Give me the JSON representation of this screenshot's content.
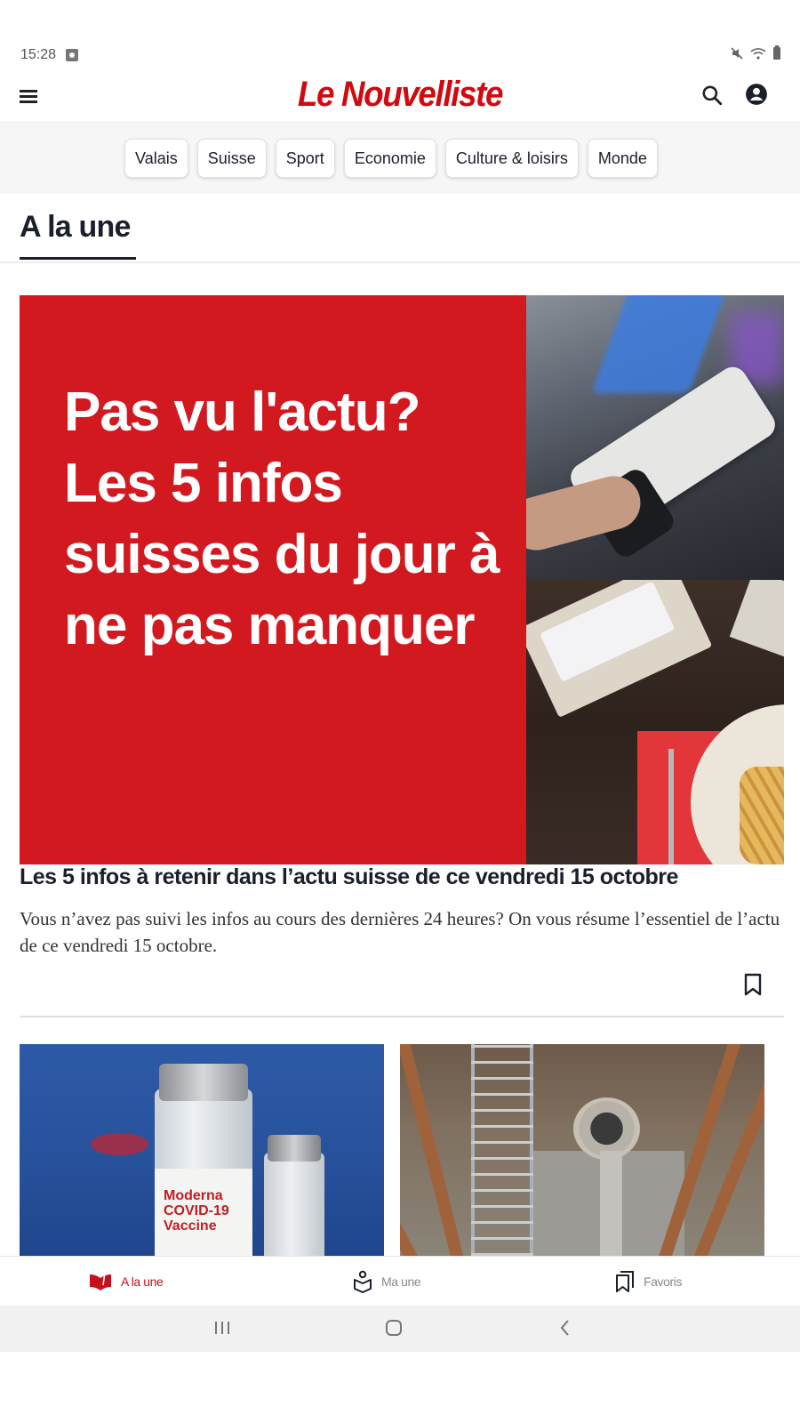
{
  "status_bar": {
    "time": "15:28",
    "icons": [
      "screen-record-icon",
      "mute-icon",
      "wifi-icon",
      "battery-icon"
    ]
  },
  "header": {
    "logo": "Le Nouvelliste",
    "menu_icon": "hamburger-menu-icon",
    "search_icon": "search-icon",
    "account_icon": "account-circle-icon"
  },
  "categories": [
    {
      "label": "Valais"
    },
    {
      "label": "Suisse"
    },
    {
      "label": "Sport"
    },
    {
      "label": "Economie"
    },
    {
      "label": "Culture & loisirs"
    },
    {
      "label": "Monde"
    }
  ],
  "section": {
    "title": "A la une"
  },
  "hero": {
    "image_text": "Pas vu l'actu? Les 5 infos suisses du jour à ne pas manquer",
    "title": "Les 5 infos à retenir dans l’actu suisse de ce vendredi 15 octobre",
    "summary": "Vous n’avez pas suivi les infos au cours des dernières 24 heures? On vous résume l’essentiel de l’actu de ce vendredi 15 octobre.",
    "bookmark_icon": "bookmark-icon",
    "accent_color": "#d21920"
  },
  "cards": [
    {
      "image": "covid-vaccine-vials",
      "label_text": "Moderna COVID-19 Vaccine"
    },
    {
      "image": "construction-pit-tunnel"
    }
  ],
  "bottom_nav": {
    "items": [
      {
        "label": "A la une",
        "icon": "open-book-icon",
        "active": true
      },
      {
        "label": "Ma une",
        "icon": "person-reading-icon",
        "active": false
      },
      {
        "label": "Favoris",
        "icon": "bookmarks-icon",
        "active": false
      }
    ],
    "active_color": "#c8101a"
  },
  "system_nav": {
    "buttons": [
      "recent-apps",
      "home",
      "back"
    ]
  }
}
